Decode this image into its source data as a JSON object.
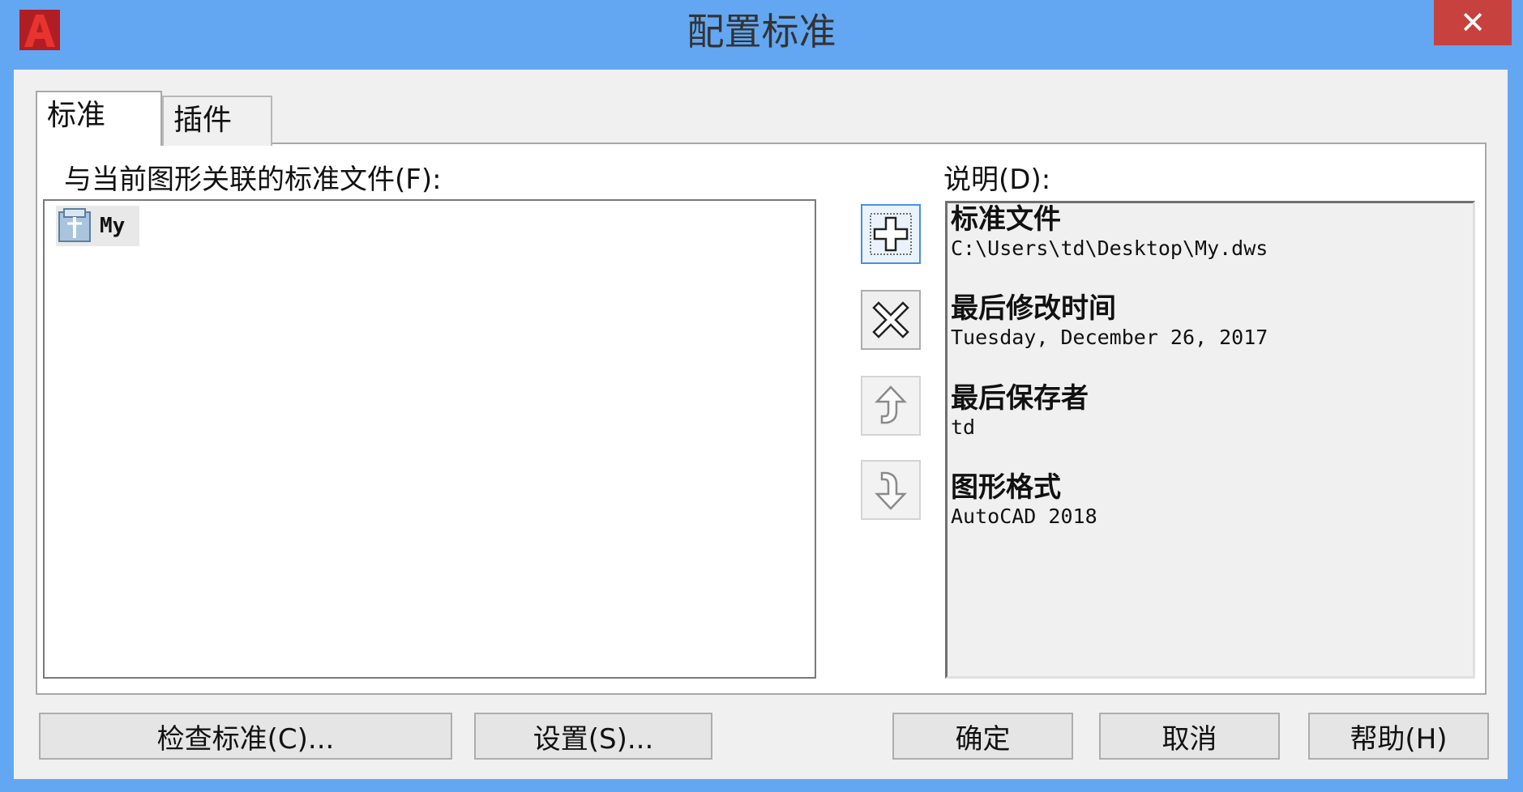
{
  "window": {
    "title": "配置标准",
    "close_glyph": "✕"
  },
  "tabs": [
    {
      "label": "标准",
      "active": true
    },
    {
      "label": "插件",
      "active": false
    }
  ],
  "standards_list": {
    "label": "与当前图形关联的标准文件(F):",
    "items": [
      {
        "name": "My",
        "icon": "standards-file-icon"
      }
    ]
  },
  "side_buttons": {
    "add": "plus-icon",
    "remove": "x-icon",
    "move_up": "arrow-up-icon",
    "move_down": "arrow-down-icon"
  },
  "description": {
    "label": "说明(D):",
    "sections": [
      {
        "heading": "标准文件",
        "value": "C:\\Users\\td\\Desktop\\My.dws"
      },
      {
        "heading": "最后修改时间",
        "value": "Tuesday, December 26, 2017"
      },
      {
        "heading": "最后保存者",
        "value": "td"
      },
      {
        "heading": "图形格式",
        "value": "AutoCAD 2018"
      }
    ]
  },
  "buttons": {
    "check": "检查标准(C)...",
    "settings": "设置(S)...",
    "ok": "确定",
    "cancel": "取消",
    "help": "帮助(H)"
  },
  "colors": {
    "titlebar": "#63a7f2",
    "close": "#c7423e",
    "accent": "#4a90d9"
  }
}
